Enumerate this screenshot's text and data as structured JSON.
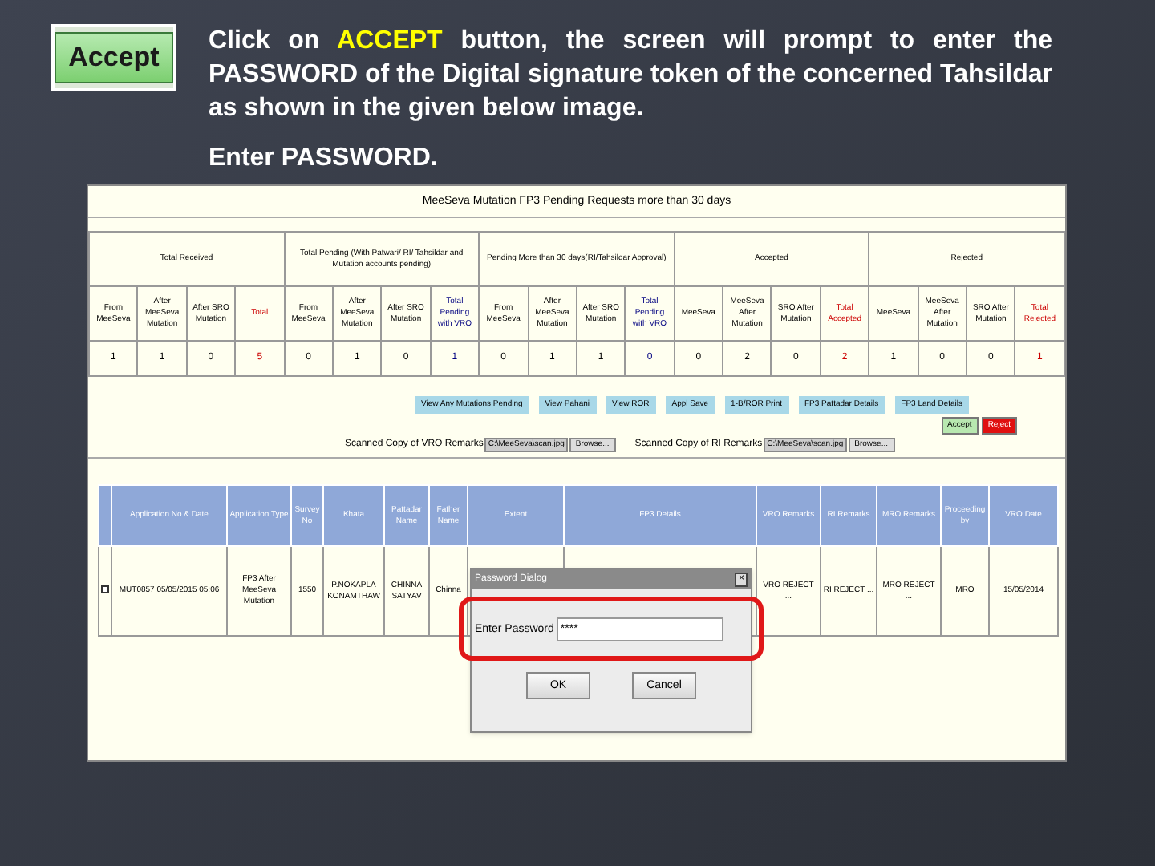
{
  "slide": {
    "text_before": "Click on ",
    "highlight": "ACCEPT",
    "text_after": " button, the screen will prompt to enter the PASSWORD of the Digital signature token of the concerned Tahsildar as shown in the given below image.",
    "instruction": "Enter PASSWORD.",
    "accept_image_label": "Accept"
  },
  "screen": {
    "title": "MeeSeva Mutation FP3 Pending Requests more than 30 days",
    "summary_table": {
      "groups": [
        "Total Received",
        "Total Pending (With Patwari/ RI/ Tahsildar and Mutation accounts pending)",
        "Pending More than 30 days(RI/Tahsildar Approval)",
        "Accepted",
        "Rejected"
      ],
      "columns": [
        {
          "label": "From MeeSeva",
          "kind": "plain"
        },
        {
          "label": "After MeeSeva Mutation",
          "kind": "plain"
        },
        {
          "label": "After SRO Mutation",
          "kind": "plain"
        },
        {
          "label": "Total",
          "kind": "total"
        },
        {
          "label": "From MeeSeva",
          "kind": "plain"
        },
        {
          "label": "After MeeSeva Mutation",
          "kind": "plain"
        },
        {
          "label": "After SRO Mutation",
          "kind": "plain"
        },
        {
          "label": "Total Pending with VRO",
          "kind": "pending"
        },
        {
          "label": "From MeeSeva",
          "kind": "plain"
        },
        {
          "label": "After MeeSeva Mutation",
          "kind": "plain"
        },
        {
          "label": "After SRO Mutation",
          "kind": "plain"
        },
        {
          "label": "Total Pending with VRO",
          "kind": "pending"
        },
        {
          "label": "MeeSeva",
          "kind": "plain"
        },
        {
          "label": "MeeSeva After Mutation",
          "kind": "plain"
        },
        {
          "label": "SRO After Mutation",
          "kind": "plain"
        },
        {
          "label": "Total Accepted",
          "kind": "total"
        },
        {
          "label": "MeeSeva",
          "kind": "plain"
        },
        {
          "label": "MeeSeva After Mutation",
          "kind": "plain"
        },
        {
          "label": "SRO After Mutation",
          "kind": "plain"
        },
        {
          "label": "Total Rejected",
          "kind": "total"
        }
      ],
      "row": [
        "1",
        "1",
        "0",
        "5",
        "0",
        "1",
        "0",
        "1",
        "0",
        "1",
        "1",
        "0",
        "0",
        "2",
        "0",
        "2",
        "1",
        "0",
        "0",
        "1"
      ]
    },
    "buttons": [
      "View Any Mutations Pending",
      "View Pahani",
      "View ROR",
      "Appl Save",
      "1-B/ROR Print",
      "FP3 Pattadar Details",
      "FP3 Land Details"
    ],
    "decision_buttons": [
      {
        "label": "Accept",
        "kind": "accept"
      },
      {
        "label": "Reject",
        "kind": "reject"
      }
    ],
    "uploads": [
      {
        "label": "Scanned Copy of VRO Remarks",
        "value": "C:\\MeeSeva\\scan.jpg",
        "button": "Browse..."
      },
      {
        "label": "Scanned Copy of RI Remarks",
        "value": "C:\\MeeSeva\\scan.jpg",
        "button": "Browse..."
      }
    ],
    "detail_table": {
      "columns": [
        "Application No & Date",
        "Application Type",
        "Survey No",
        "Khata",
        "Pattadar Name",
        "Father Name",
        "Extent",
        "FP3 Details",
        "VRO Remarks",
        "RI Remarks",
        "MRO Remarks",
        "Proceeding by",
        "VRO Date"
      ],
      "rows": [
        {
          "checked": false,
          "cells": [
            "MUT0857 05/05/2015 05:06",
            "FP3 After MeeSeva Mutation",
            "1550",
            "P.NOKAPLA KONAMTHAW",
            "CHINNA SATYAV",
            "Chinna",
            "",
            "",
            "VRO REJECT ...",
            "RI REJECT ...",
            "MRO REJECT ...",
            "MRO",
            "15/05/2014"
          ]
        }
      ]
    },
    "dialog": {
      "title": "Password Dialog",
      "close": "×",
      "label": "Enter Password",
      "value": "****",
      "buttons": [
        "OK",
        "Cancel"
      ]
    }
  }
}
